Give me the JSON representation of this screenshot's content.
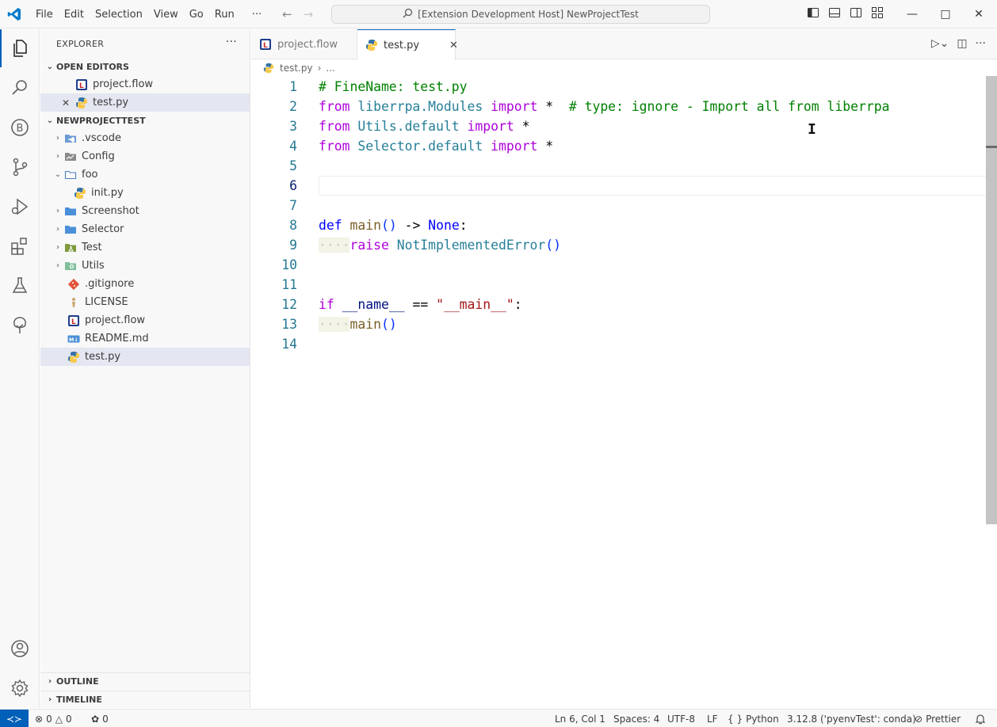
{
  "titlebar": {
    "menu": [
      "File",
      "Edit",
      "Selection",
      "View",
      "Go",
      "Run",
      "···"
    ],
    "command_center": "[Extension Development Host] NewProjectTest"
  },
  "sidebar": {
    "header": "EXPLORER",
    "open_editors_title": "OPEN EDITORS",
    "open_editors": [
      "project.flow",
      "test.py"
    ],
    "project_title": "NEWPROJECTTEST",
    "tree": [
      ".vscode",
      "Config",
      "foo",
      "init.py",
      "Screenshot",
      "Selector",
      "Test",
      "Utils",
      ".gitignore",
      "LICENSE",
      "project.flow",
      "README.md",
      "test.py"
    ],
    "outline_title": "OUTLINE",
    "timeline_title": "TIMELINE"
  },
  "tabs": [
    "project.flow",
    "test.py"
  ],
  "breadcrumb": {
    "file": "test.py",
    "rest": "..."
  },
  "editor": {
    "line_numbers": [
      "1",
      "2",
      "3",
      "4",
      "5",
      "6",
      "7",
      "8",
      "9",
      "10",
      "11",
      "12",
      "13",
      "14"
    ],
    "current_line": 6
  },
  "statusbar": {
    "errors": "0",
    "warnings": "0",
    "ports": "0",
    "position": "Ln 6, Col 1",
    "spaces": "Spaces: 4",
    "encoding": "UTF-8",
    "eol": "LF",
    "language": "Python",
    "interpreter": "3.12.8 ('pyenvTest': conda)",
    "prettier": "Prettier"
  },
  "colors": {
    "accent": "#005fb8",
    "selection": "#e4e6f1",
    "keyword": "#af00db",
    "type": "#267f99",
    "comment": "#008000"
  }
}
